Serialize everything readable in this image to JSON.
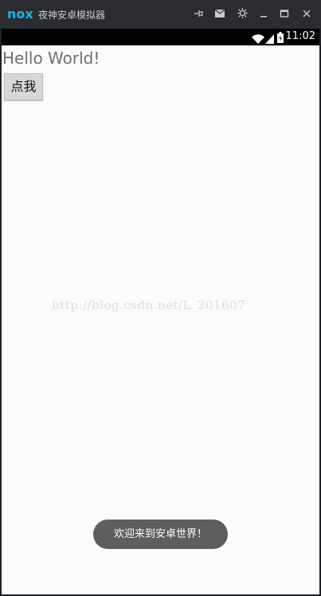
{
  "window": {
    "logo_text": "nox",
    "title": "夜神安卓模拟器",
    "controls": [
      "pin",
      "message",
      "settings",
      "minimize",
      "maximize",
      "close"
    ]
  },
  "status_bar": {
    "time": "11:02",
    "icons": [
      "wifi-icon",
      "signal-icon",
      "battery-icon"
    ]
  },
  "app": {
    "hello_text": "Hello World!",
    "button_label": "点我",
    "watermark": "http://blog.csdn.net/L_201607",
    "toast": "欢迎来到安卓世界！"
  },
  "colors": {
    "accent": "#19b6e5",
    "titlebar": "#2a2c31",
    "toast_bg": "#5e5e5e"
  }
}
